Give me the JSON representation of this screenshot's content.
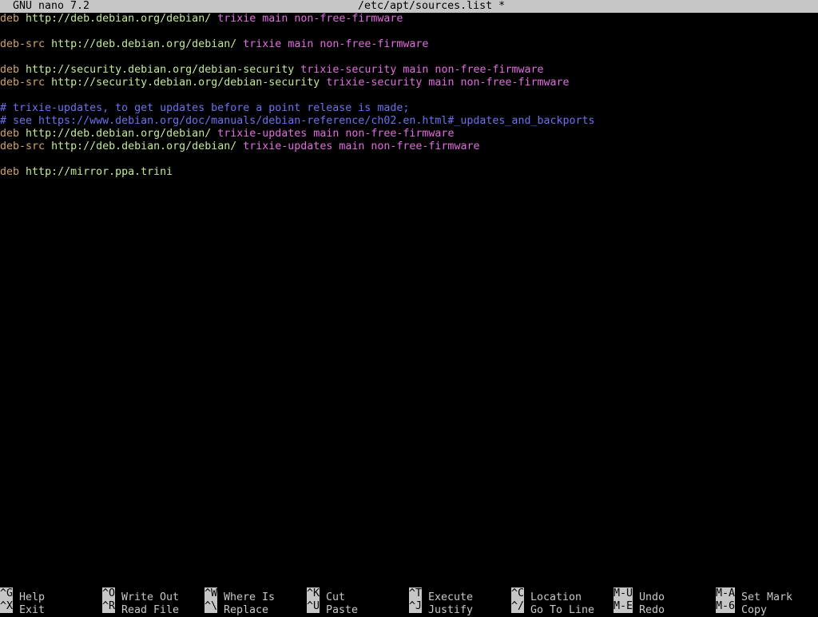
{
  "titlebar": {
    "app": "GNU nano 7.2",
    "file": "/etc/apt/sources.list *"
  },
  "editor": {
    "lines": [
      {
        "kw": "deb",
        "url": "http://deb.debian.org/debian/",
        "suite": "trixie",
        "comp": "main non-free-firmware"
      },
      {
        "blank": true
      },
      {
        "kw": "deb-src",
        "url": "http://deb.debian.org/debian/",
        "suite": "trixie",
        "comp": "main non-free-firmware"
      },
      {
        "blank": true
      },
      {
        "kw": "deb",
        "url": "http://security.debian.org/debian-security",
        "suite": "trixie-security",
        "comp": "main non-free-firmware"
      },
      {
        "kw": "deb-src",
        "url": "http://security.debian.org/debian-security",
        "suite": "trixie-security",
        "comp": "main non-free-firmware"
      },
      {
        "blank": true
      },
      {
        "comment": "# trixie-updates, to get updates before a point release is made;"
      },
      {
        "comment": "# see https://www.debian.org/doc/manuals/debian-reference/ch02.en.html#_updates_and_backports"
      },
      {
        "kw": "deb",
        "url": "http://deb.debian.org/debian/",
        "suite": "trixie-updates",
        "comp": "main non-free-firmware"
      },
      {
        "kw": "deb-src",
        "url": "http://deb.debian.org/debian/",
        "suite": "trixie-updates",
        "comp": "main non-free-firmware"
      },
      {
        "blank": true
      },
      {
        "kw": "deb",
        "url": "http://mirror.ppa.trini",
        "suite": "",
        "comp": ""
      }
    ]
  },
  "shortcuts": {
    "row1": [
      {
        "key": "^G",
        "label": "Help"
      },
      {
        "key": "^O",
        "label": "Write Out"
      },
      {
        "key": "^W",
        "label": "Where Is"
      },
      {
        "key": "^K",
        "label": "Cut"
      },
      {
        "key": "^T",
        "label": "Execute"
      },
      {
        "key": "^C",
        "label": "Location"
      },
      {
        "key": "M-U",
        "label": "Undo"
      },
      {
        "key": "M-A",
        "label": "Set Mark"
      }
    ],
    "row2": [
      {
        "key": "^X",
        "label": "Exit"
      },
      {
        "key": "^R",
        "label": "Read File"
      },
      {
        "key": "^\\",
        "label": "Replace"
      },
      {
        "key": "^U",
        "label": "Paste"
      },
      {
        "key": "^J",
        "label": "Justify"
      },
      {
        "key": "^/",
        "label": "Go To Line"
      },
      {
        "key": "M-E",
        "label": "Redo"
      },
      {
        "key": "M-6",
        "label": "Copy"
      }
    ]
  },
  "colors": {
    "background": "#000000",
    "bar": "#c6c6c6",
    "keyword": "#d0a468",
    "url": "#c4ea93",
    "suite": "#e06de0",
    "comment": "#6f6ff2"
  }
}
